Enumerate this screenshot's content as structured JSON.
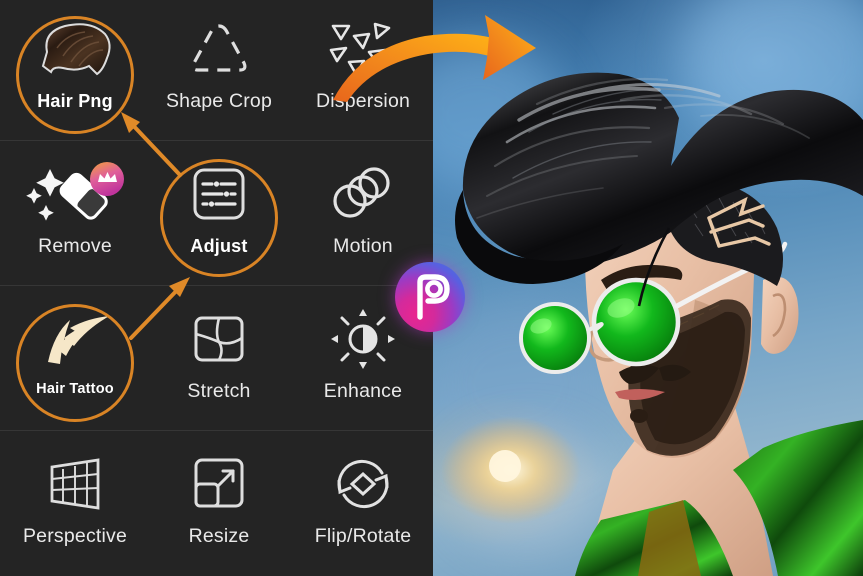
{
  "app": {
    "name": "PicsArt",
    "logo_icon": "picsart-logo-icon",
    "panel_bg": "#242424",
    "accent": "#d98425",
    "label_color": "#e9e9e9"
  },
  "tools_panel": {
    "columns": 3,
    "rows": 4,
    "items": [
      {
        "label": "Hair Png",
        "icon": "hair-png-icon",
        "highlighted": true,
        "premium": false
      },
      {
        "label": "Shape Crop",
        "icon": "shape-crop-icon",
        "highlighted": false,
        "premium": false
      },
      {
        "label": "Dispersion",
        "icon": "dispersion-icon",
        "highlighted": false,
        "premium": false
      },
      {
        "label": "Remove",
        "icon": "remove-eraser-icon",
        "highlighted": false,
        "premium": true
      },
      {
        "label": "Adjust",
        "icon": "adjust-sliders-icon",
        "highlighted": true,
        "premium": false
      },
      {
        "label": "Motion",
        "icon": "motion-icon",
        "highlighted": false,
        "premium": false
      },
      {
        "label": "Hair Tattoo",
        "icon": "hair-tattoo-icon",
        "highlighted": true,
        "premium": false
      },
      {
        "label": "Stretch",
        "icon": "stretch-icon",
        "highlighted": false,
        "premium": false
      },
      {
        "label": "Enhance",
        "icon": "enhance-icon",
        "highlighted": false,
        "premium": false
      },
      {
        "label": "Perspective",
        "icon": "perspective-icon",
        "highlighted": false,
        "premium": false
      },
      {
        "label": "Resize",
        "icon": "resize-icon",
        "highlighted": false,
        "premium": false
      },
      {
        "label": "Flip/Rotate",
        "icon": "flip-rotate-icon",
        "highlighted": false,
        "premium": false
      }
    ]
  },
  "annotations": {
    "highlight_color": "#d98425",
    "arrow_color": "#e08a28",
    "big_arrow_color_start": "#e8661c",
    "big_arrow_color_end": "#ffb316",
    "connectors": [
      {
        "name": "adjust-to-hair-png",
        "from": "Adjust",
        "to": "Hair Png"
      },
      {
        "name": "hair-tattoo-to-adjust",
        "from": "Hair Tattoo",
        "to": "Adjust"
      }
    ],
    "result_arrow": {
      "name": "dispersion-to-result",
      "from": "Dispersion",
      "to": "edited-photo"
    }
  },
  "preview": {
    "name": "edited-photo",
    "subject": "man-portrait",
    "hair_style": "black-pompadour",
    "hair_tattoo_visible": true,
    "sunglasses_color": "#1fbf2c",
    "jacket_color": "#2fae22",
    "background": "blue-bokeh"
  }
}
